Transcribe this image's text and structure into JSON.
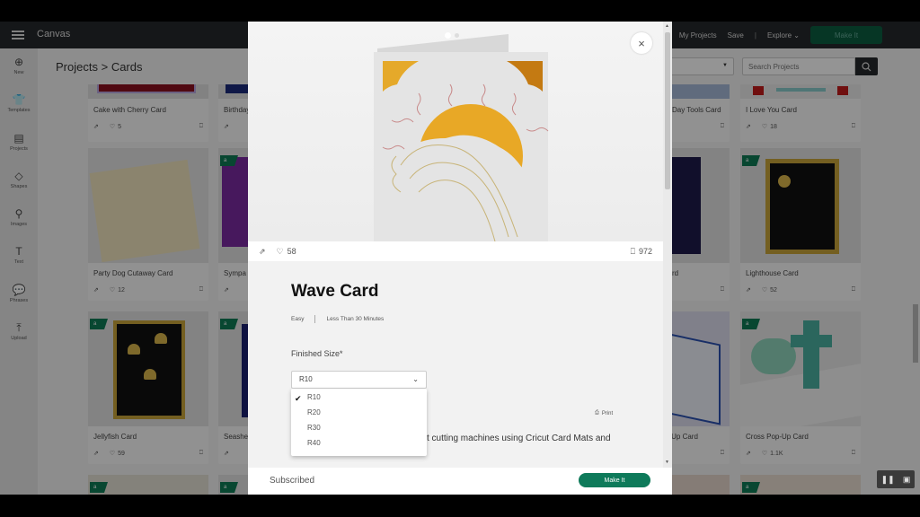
{
  "topbar": {
    "menu_icon": "hamburger-icon",
    "title": "Canvas",
    "nav": {
      "my_projects": "My Projects",
      "save": "Save",
      "separator": "|",
      "explore": "Explore",
      "make_it": "Make It"
    }
  },
  "sidebar": {
    "items": [
      {
        "label": "New",
        "icon": "⊕"
      },
      {
        "label": "Templates",
        "icon": "👕"
      },
      {
        "label": "Projects",
        "icon": "▤"
      },
      {
        "label": "Shapes",
        "icon": "◇"
      },
      {
        "label": "Images",
        "icon": "⚲"
      },
      {
        "label": "Text",
        "icon": "T"
      },
      {
        "label": "Phrases",
        "icon": "💬"
      },
      {
        "label": "Upload",
        "icon": "⤒"
      }
    ]
  },
  "breadcrumb": {
    "parent": "Projects",
    "separator": ">",
    "current": "Cards"
  },
  "search": {
    "placeholder": "Search Projects"
  },
  "cards": [
    {
      "name": "Cake with Cherry Card",
      "likes": "5"
    },
    {
      "name": "Birthday",
      "likes": ""
    },
    {
      "name": "Day Tools Card",
      "likes": ""
    },
    {
      "name": "I Love You Card",
      "likes": "18"
    },
    {
      "name": "Party Dog Cutaway Card",
      "likes": "12"
    },
    {
      "name": "Sympa",
      "likes": ""
    },
    {
      "name": "rd",
      "likes": ""
    },
    {
      "name": "Lighthouse Card",
      "likes": "52"
    },
    {
      "name": "Jellyfish Card",
      "likes": "59"
    },
    {
      "name": "Seashe",
      "likes": ""
    },
    {
      "name": "p-Up Card",
      "likes": ""
    },
    {
      "name": "Cross Pop-Up Card",
      "likes": "1.1K"
    }
  ],
  "badge_icon": "a",
  "modal": {
    "close_icon": "×",
    "likes": "58",
    "saves": "972",
    "title": "Wave Card",
    "difficulty": "Easy",
    "time": "Less Than 30 Minutes",
    "finished_size_label": "Finished Size*",
    "selected_size": "R10",
    "size_options": [
      "R10",
      "R20",
      "R30",
      "R40"
    ],
    "print_label": "Print",
    "description_fragment": "t cutting machines using Cricut Card Mats and",
    "footer_status": "Subscribed",
    "make_it_label": "Make It"
  },
  "colors": {
    "accent": "#0e7a5a",
    "topbar": "#25282b"
  }
}
